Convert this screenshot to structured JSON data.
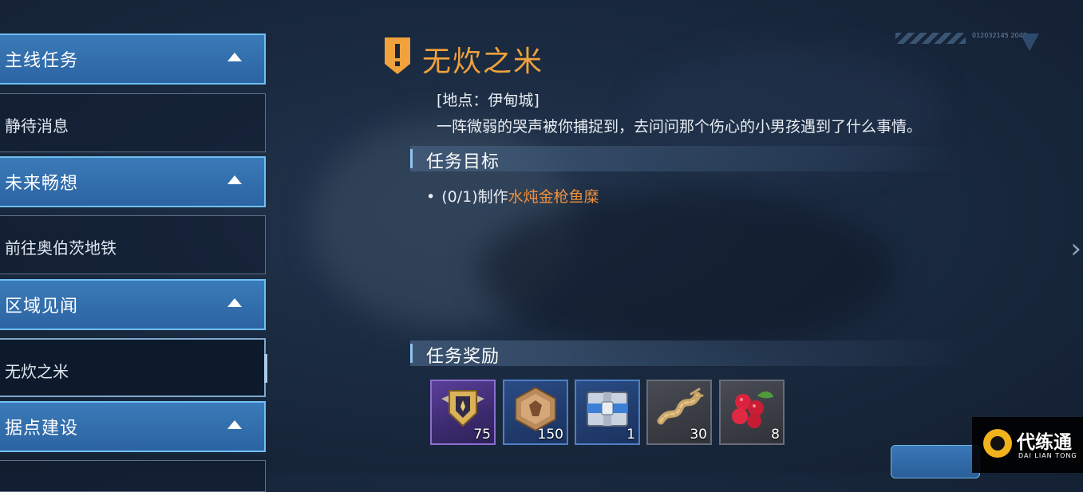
{
  "sidebar": {
    "categories": [
      {
        "label": "主线任务",
        "items": [
          "静待消息"
        ]
      },
      {
        "label": "未来畅想",
        "items": [
          "前往奥伯茨地铁"
        ]
      },
      {
        "label": "区域见闻",
        "items": [
          "无炊之米"
        ]
      },
      {
        "label": "据点建设",
        "items": []
      }
    ],
    "active_item": "无炊之米"
  },
  "quest": {
    "title": "无炊之米",
    "location": "[地点：伊甸城]",
    "description": "一阵微弱的哭声被你捕捉到，去问问那个伤心的小男孩遇到了什么事情。",
    "objectives_header": "任务目标",
    "objective_prefix": "(0/1)制作",
    "objective_target": "水炖金枪鱼糜",
    "rewards_header": "任务奖励",
    "rewards": [
      {
        "icon": "gold-shield-badge-icon",
        "count": "75",
        "rarity": "purple"
      },
      {
        "icon": "bronze-token-icon",
        "count": "150",
        "rarity": "blue"
      },
      {
        "icon": "supply-crate-icon",
        "count": "1",
        "rarity": "blue"
      },
      {
        "icon": "rope-coil-icon",
        "count": "30",
        "rarity": "grey"
      },
      {
        "icon": "raspberry-icon",
        "count": "8",
        "rarity": "grey"
      }
    ]
  },
  "decor": {
    "code_text": "012032145 2048"
  },
  "watermark": {
    "title": "代练通",
    "subtitle": "DAI LIAN TONG"
  },
  "colors": {
    "title_orange": "#f0a23c",
    "highlight_orange": "#ef8f3e",
    "category_blue": "#2c64a2",
    "accent_cyan": "#6fc0f2"
  }
}
